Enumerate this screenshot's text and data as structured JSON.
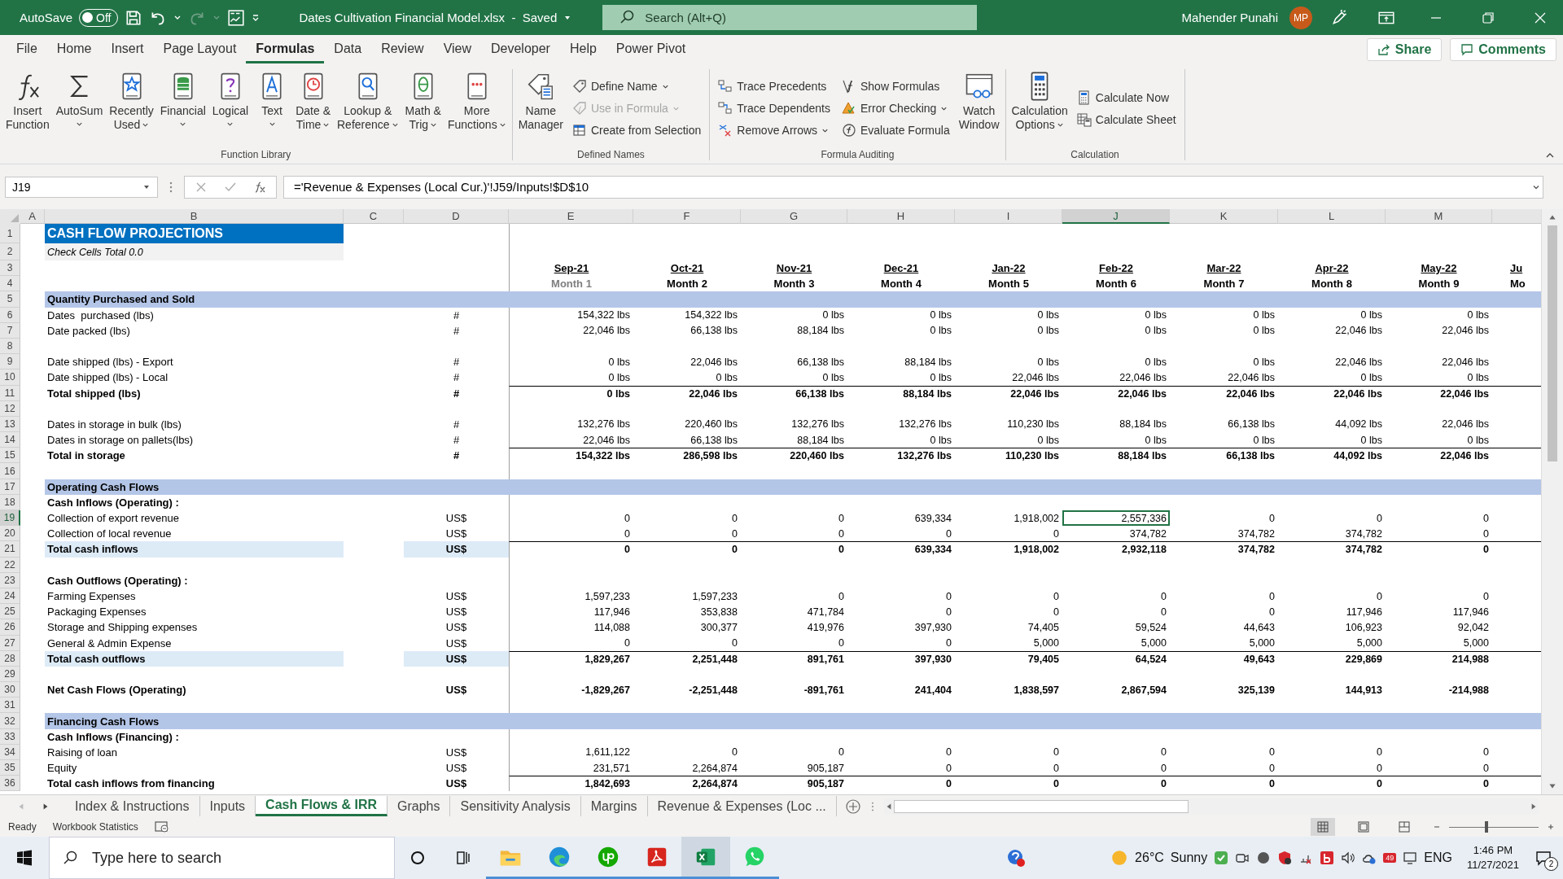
{
  "title_bar": {
    "autosave_label": "AutoSave",
    "autosave": {
      "on": false,
      "label": "Off"
    },
    "redo_disabled": true,
    "document": "Dates Cultivation Financial Model.xlsx  -  Saved",
    "search": {
      "placeholder": "Search (Alt+Q)"
    },
    "user": "Mahender Punahi",
    "avatar": "MP"
  },
  "menu_tabs": [
    {
      "label": "File",
      "selected": false
    },
    {
      "label": "Home",
      "selected": false
    },
    {
      "label": "Insert",
      "selected": false
    },
    {
      "label": "Page Layout",
      "selected": false
    },
    {
      "label": "Formulas",
      "selected": true
    },
    {
      "label": "Data",
      "selected": false
    },
    {
      "label": "Review",
      "selected": false
    },
    {
      "label": "View",
      "selected": false
    },
    {
      "label": "Developer",
      "selected": false
    },
    {
      "label": "Help",
      "selected": false
    },
    {
      "label": "Power Pivot",
      "selected": false
    }
  ],
  "share": "Share",
  "comments": "Comments",
  "ribbon": {
    "groups": [
      {
        "label": "Function Library",
        "items": [
          {
            "kind": "large",
            "lines": [
              "Insert",
              "Function"
            ],
            "dropdown": false
          },
          {
            "kind": "large",
            "lines": [
              "AutoSum"
            ],
            "dropdown": true
          },
          {
            "kind": "large",
            "lines": [
              "Recently",
              "Used"
            ],
            "dropdown": true
          },
          {
            "kind": "large",
            "lines": [
              "Financial"
            ],
            "dropdown": true
          },
          {
            "kind": "large",
            "lines": [
              "Logical"
            ],
            "dropdown": true
          },
          {
            "kind": "large",
            "lines": [
              "Text"
            ],
            "dropdown": true
          },
          {
            "kind": "large",
            "lines": [
              "Date &",
              "Time"
            ],
            "dropdown": true
          },
          {
            "kind": "large",
            "lines": [
              "Lookup &",
              "Reference"
            ],
            "dropdown": true
          },
          {
            "kind": "large",
            "lines": [
              "Math &",
              "Trig"
            ],
            "dropdown": true
          },
          {
            "kind": "large",
            "lines": [
              "More",
              "Functions"
            ],
            "dropdown": true
          }
        ]
      },
      {
        "label": "Defined Names",
        "items": [
          {
            "kind": "large",
            "lines": [
              "Name",
              "Manager"
            ],
            "dropdown": false
          },
          {
            "kind": "stack",
            "items": [
              {
                "label": "Define Name",
                "dropdown": true,
                "disabled": false
              },
              {
                "label": "Use in Formula",
                "dropdown": true,
                "disabled": true
              },
              {
                "label": "Create from Selection",
                "dropdown": false,
                "disabled": false
              }
            ]
          }
        ]
      },
      {
        "label": "Formula Auditing",
        "items": [
          {
            "kind": "stack",
            "items": [
              {
                "label": "Trace Precedents",
                "dropdown": false,
                "disabled": false
              },
              {
                "label": "Trace Dependents",
                "dropdown": false,
                "disabled": false
              },
              {
                "label": "Remove Arrows",
                "dropdown": true,
                "disabled": false
              }
            ]
          },
          {
            "kind": "stack",
            "items": [
              {
                "label": "Show Formulas",
                "dropdown": false,
                "disabled": false
              },
              {
                "label": "Error Checking",
                "dropdown": true,
                "disabled": false
              },
              {
                "label": "Evaluate Formula",
                "dropdown": false,
                "disabled": false
              }
            ]
          },
          {
            "kind": "large",
            "lines": [
              "Watch",
              "Window"
            ],
            "dropdown": false
          }
        ]
      },
      {
        "label": "Calculation",
        "items": [
          {
            "kind": "large",
            "lines": [
              "Calculation",
              "Options"
            ],
            "dropdown": true
          },
          {
            "kind": "stack",
            "items": [
              {
                "label": "Calculate Now",
                "dropdown": false,
                "disabled": false
              },
              {
                "label": "Calculate Sheet",
                "dropdown": false,
                "disabled": false
              }
            ]
          }
        ]
      }
    ]
  },
  "formula_bar": {
    "name_box": "J19",
    "formula": "='Revenue & Expenses (Local Cur.)'!J59/Inputs!$D$10"
  },
  "columns": [
    {
      "label": "A",
      "selected": false
    },
    {
      "label": "B",
      "selected": false
    },
    {
      "label": "C",
      "selected": false
    },
    {
      "label": "D",
      "selected": false
    },
    {
      "label": "E",
      "selected": false
    },
    {
      "label": "F",
      "selected": false
    },
    {
      "label": "G",
      "selected": false
    },
    {
      "label": "H",
      "selected": false
    },
    {
      "label": "I",
      "selected": false
    },
    {
      "label": "J",
      "selected": true
    },
    {
      "label": "K",
      "selected": false
    },
    {
      "label": "L",
      "selected": false
    },
    {
      "label": "M",
      "selected": false
    }
  ],
  "rows": [
    {
      "num": "1",
      "kind": "title",
      "label": "CASH FLOW PROJECTIONS",
      "selected": false
    },
    {
      "num": "2",
      "kind": "note",
      "label": "Check Cells Total 0.0",
      "selected": false
    },
    {
      "num": "3",
      "kind": "dates",
      "values": [
        "Sep-21",
        "Oct-21",
        "Nov-21",
        "Dec-21",
        "Jan-22",
        "Feb-22",
        "Mar-22",
        "Apr-22",
        "May-22",
        "Ju"
      ],
      "selected": false
    },
    {
      "num": "4",
      "kind": "months",
      "values": [
        "Month 1",
        "Month 2",
        "Month 3",
        "Month 4",
        "Month 5",
        "Month 6",
        "Month 7",
        "Month 8",
        "Month 9",
        "Mo"
      ],
      "selected": false
    },
    {
      "num": "5",
      "kind": "section",
      "label": "Quantity Purchased and Sold",
      "selected": false
    },
    {
      "num": "6",
      "kind": "item",
      "label": "Dates  purchased (lbs)",
      "unit": "#",
      "values": [
        "154,322 lbs",
        "154,322 lbs",
        "0 lbs",
        "0 lbs",
        "0 lbs",
        "0 lbs",
        "0 lbs",
        "0 lbs",
        "0 lbs"
      ],
      "selected": false
    },
    {
      "num": "7",
      "kind": "item",
      "label": "Date packed (lbs)",
      "unit": "#",
      "values": [
        "22,046 lbs",
        "66,138 lbs",
        "88,184 lbs",
        "0 lbs",
        "0 lbs",
        "0 lbs",
        "0 lbs",
        "22,046 lbs",
        "22,046 lbs"
      ],
      "selected": false
    },
    {
      "num": "8",
      "kind": "blank",
      "selected": false
    },
    {
      "num": "9",
      "kind": "item",
      "label": "Date shipped (lbs) - Export",
      "unit": "#",
      "values": [
        "0 lbs",
        "22,046 lbs",
        "66,138 lbs",
        "88,184 lbs",
        "0 lbs",
        "0 lbs",
        "0 lbs",
        "22,046 lbs",
        "22,046 lbs"
      ],
      "selected": false
    },
    {
      "num": "10",
      "kind": "item",
      "label": "Date shipped (lbs) - Local",
      "unit": "#",
      "values": [
        "0 lbs",
        "0 lbs",
        "0 lbs",
        "0 lbs",
        "22,046 lbs",
        "22,046 lbs",
        "22,046 lbs",
        "0 lbs",
        "0 lbs"
      ],
      "selected": false
    },
    {
      "num": "11",
      "kind": "total",
      "highlight": false,
      "label": "Total shipped (lbs)",
      "unit": "#",
      "values": [
        "0 lbs",
        "22,046 lbs",
        "66,138 lbs",
        "88,184 lbs",
        "22,046 lbs",
        "22,046 lbs",
        "22,046 lbs",
        "22,046 lbs",
        "22,046 lbs"
      ],
      "selected": false
    },
    {
      "num": "12",
      "kind": "blank",
      "selected": false
    },
    {
      "num": "13",
      "kind": "item",
      "label": "Dates in storage in bulk (lbs)",
      "unit": "#",
      "values": [
        "132,276 lbs",
        "220,460 lbs",
        "132,276 lbs",
        "132,276 lbs",
        "110,230 lbs",
        "88,184 lbs",
        "66,138 lbs",
        "44,092 lbs",
        "22,046 lbs"
      ],
      "selected": false
    },
    {
      "num": "14",
      "kind": "item",
      "label": "Dates in storage on pallets(lbs)",
      "unit": "#",
      "values": [
        "22,046 lbs",
        "66,138 lbs",
        "88,184 lbs",
        "0 lbs",
        "0 lbs",
        "0 lbs",
        "0 lbs",
        "0 lbs",
        "0 lbs"
      ],
      "selected": false
    },
    {
      "num": "15",
      "kind": "total",
      "highlight": false,
      "label": "Total in storage",
      "unit": "#",
      "values": [
        "154,322 lbs",
        "286,598 lbs",
        "220,460 lbs",
        "132,276 lbs",
        "110,230 lbs",
        "88,184 lbs",
        "66,138 lbs",
        "44,092 lbs",
        "22,046 lbs"
      ],
      "selected": false
    },
    {
      "num": "16",
      "kind": "blank",
      "selected": false
    },
    {
      "num": "17",
      "kind": "section",
      "label": "Operating Cash Flows",
      "selected": false
    },
    {
      "num": "18",
      "kind": "subheader",
      "label": "Cash Inflows (Operating) :",
      "selected": false
    },
    {
      "num": "19",
      "kind": "item",
      "label": "Collection of export revenue",
      "unit": "US$",
      "values": [
        "0",
        "0",
        "0",
        "639,334",
        "1,918,002",
        "2,557,336",
        "0",
        "0",
        "0"
      ],
      "selected": true
    },
    {
      "num": "20",
      "kind": "item",
      "label": "Collection of local revenue",
      "unit": "US$",
      "values": [
        "0",
        "0",
        "0",
        "0",
        "0",
        "374,782",
        "374,782",
        "374,782",
        "0"
      ],
      "selected": false
    },
    {
      "num": "21",
      "kind": "total",
      "highlight": true,
      "label": "Total cash inflows",
      "unit": "US$",
      "values": [
        "0",
        "0",
        "0",
        "639,334",
        "1,918,002",
        "2,932,118",
        "374,782",
        "374,782",
        "0"
      ],
      "selected": false
    },
    {
      "num": "22",
      "kind": "blank",
      "selected": false
    },
    {
      "num": "23",
      "kind": "subheader",
      "label": "Cash Outflows (Operating) :",
      "selected": false
    },
    {
      "num": "24",
      "kind": "item",
      "label": "Farming Expenses",
      "unit": "US$",
      "values": [
        "1,597,233",
        "1,597,233",
        "0",
        "0",
        "0",
        "0",
        "0",
        "0",
        "0"
      ],
      "selected": false
    },
    {
      "num": "25",
      "kind": "item",
      "label": "Packaging Expenses",
      "unit": "US$",
      "values": [
        "117,946",
        "353,838",
        "471,784",
        "0",
        "0",
        "0",
        "0",
        "117,946",
        "117,946"
      ],
      "selected": false
    },
    {
      "num": "26",
      "kind": "item",
      "label": "Storage and Shipping expenses",
      "unit": "US$",
      "values": [
        "114,088",
        "300,377",
        "419,976",
        "397,930",
        "74,405",
        "59,524",
        "44,643",
        "106,923",
        "92,042"
      ],
      "selected": false
    },
    {
      "num": "27",
      "kind": "item",
      "label": "General & Admin Expense",
      "unit": "US$",
      "values": [
        "0",
        "0",
        "0",
        "0",
        "5,000",
        "5,000",
        "5,000",
        "5,000",
        "5,000"
      ],
      "selected": false
    },
    {
      "num": "28",
      "kind": "total",
      "highlight": true,
      "label": "Total cash outflows",
      "unit": "US$",
      "values": [
        "1,829,267",
        "2,251,448",
        "891,761",
        "397,930",
        "79,405",
        "64,524",
        "49,643",
        "229,869",
        "214,988"
      ],
      "selected": false
    },
    {
      "num": "29",
      "kind": "blank",
      "selected": false
    },
    {
      "num": "30",
      "kind": "net",
      "label": "Net Cash Flows (Operating)",
      "unit": "US$",
      "values": [
        "-1,829,267",
        "-2,251,448",
        "-891,761",
        "241,404",
        "1,838,597",
        "2,867,594",
        "325,139",
        "144,913",
        "-214,988"
      ],
      "selected": false
    },
    {
      "num": "31",
      "kind": "blank",
      "selected": false
    },
    {
      "num": "32",
      "kind": "section",
      "label": "Financing Cash Flows",
      "selected": false
    },
    {
      "num": "33",
      "kind": "subheader",
      "label": "Cash Inflows (Financing) :",
      "selected": false
    },
    {
      "num": "34",
      "kind": "item",
      "label": "Raising of loan",
      "unit": "US$",
      "values": [
        "1,611,122",
        "0",
        "0",
        "0",
        "0",
        "0",
        "0",
        "0",
        "0"
      ],
      "selected": false
    },
    {
      "num": "35",
      "kind": "item",
      "label": "Equity",
      "unit": "US$",
      "values": [
        "231,571",
        "2,264,874",
        "905,187",
        "0",
        "0",
        "0",
        "0",
        "0",
        "0"
      ],
      "selected": false
    },
    {
      "num": "36",
      "kind": "total",
      "highlight": false,
      "label": "Total cash inflows from financing",
      "unit": "US$",
      "values": [
        "1,842,693",
        "2,264,874",
        "905,187",
        "0",
        "0",
        "0",
        "0",
        "0",
        "0"
      ],
      "selected": false
    }
  ],
  "sheet_tabs": [
    {
      "label": "Index & Instructions",
      "selected": false
    },
    {
      "label": "Inputs",
      "selected": false
    },
    {
      "label": "Cash Flows & IRR",
      "selected": true
    },
    {
      "label": "Graphs",
      "selected": false
    },
    {
      "label": "Sensitivity Analysis",
      "selected": false
    },
    {
      "label": "Margins",
      "selected": false
    },
    {
      "label": "Revenue & Expenses (Loc ...",
      "selected": false
    }
  ],
  "status_bar": {
    "mode": "Ready",
    "stats": "Workbook Statistics",
    "views": [
      {
        "selected": true
      },
      {
        "selected": false
      },
      {
        "selected": false
      }
    ],
    "zoom": {
      "level": 0.42
    }
  },
  "taskbar": {
    "search": {
      "placeholder": "Type here to search"
    },
    "apps": [
      {
        "selected": false
      },
      {
        "selected": false
      },
      {
        "selected": false
      },
      {
        "selected": false
      },
      {
        "selected": true
      },
      {
        "selected": false
      }
    ],
    "temperature": "26°C",
    "weather": "Sunny",
    "calendar_badge": "49",
    "language": "ENG",
    "time": "1:46 PM",
    "date": "11/27/2021",
    "notifications": "2"
  }
}
